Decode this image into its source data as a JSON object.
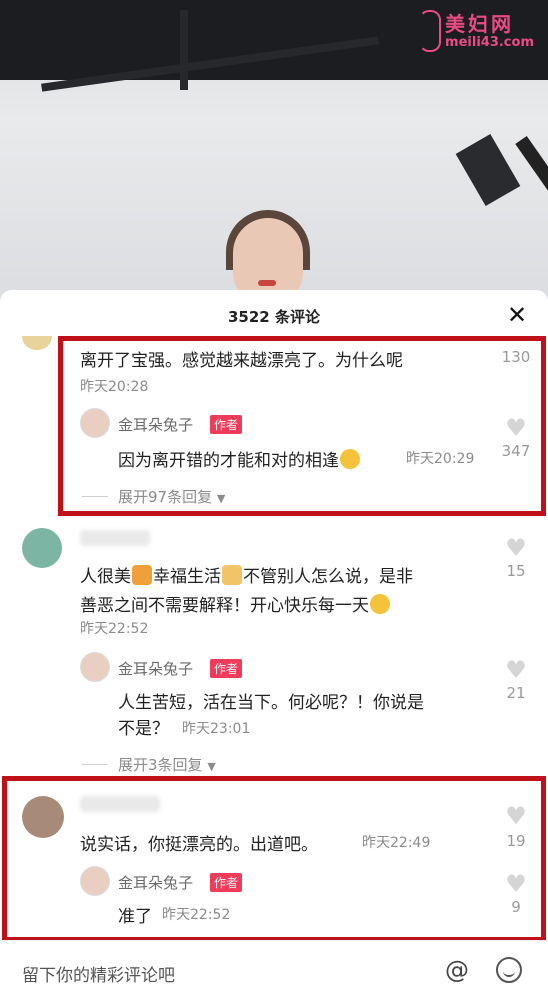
{
  "watermark": {
    "brand": "美妇网",
    "domain": "meili43.com"
  },
  "panel": {
    "title": "3522 条评论",
    "input_placeholder": "留下你的精彩评论吧"
  },
  "comments": [
    {
      "text": "离开了宝强。感觉越来越漂亮了。为什么呢",
      "time": "昨天20:28",
      "likes": "130",
      "reply": {
        "author": "金耳朵兔子",
        "badge": "作者",
        "text": "因为离开错的才能和对的相逢",
        "time": "昨天20:29",
        "likes": "347"
      },
      "expand": "展开97条回复"
    },
    {
      "text_line1": "人很美",
      "text_line1b": "幸福生活",
      "text_line1c": "不管别人怎么说，是非",
      "text_line2": "善恶之间不需要解释！开心快乐每一天",
      "time": "昨天22:52",
      "likes": "15",
      "reply": {
        "author": "金耳朵兔子",
        "badge": "作者",
        "text_line1": "人生苦短，活在当下。何必呢？！你说是",
        "text_line2": "不是？",
        "time": "昨天23:01",
        "likes": "21"
      },
      "expand": "展开3条回复"
    },
    {
      "text": "说实话，你挺漂亮的。出道吧。",
      "time": "昨天22:49",
      "likes": "19",
      "reply": {
        "author": "金耳朵兔子",
        "badge": "作者",
        "text": "准了",
        "time": "昨天22:52",
        "likes": "9"
      }
    }
  ]
}
